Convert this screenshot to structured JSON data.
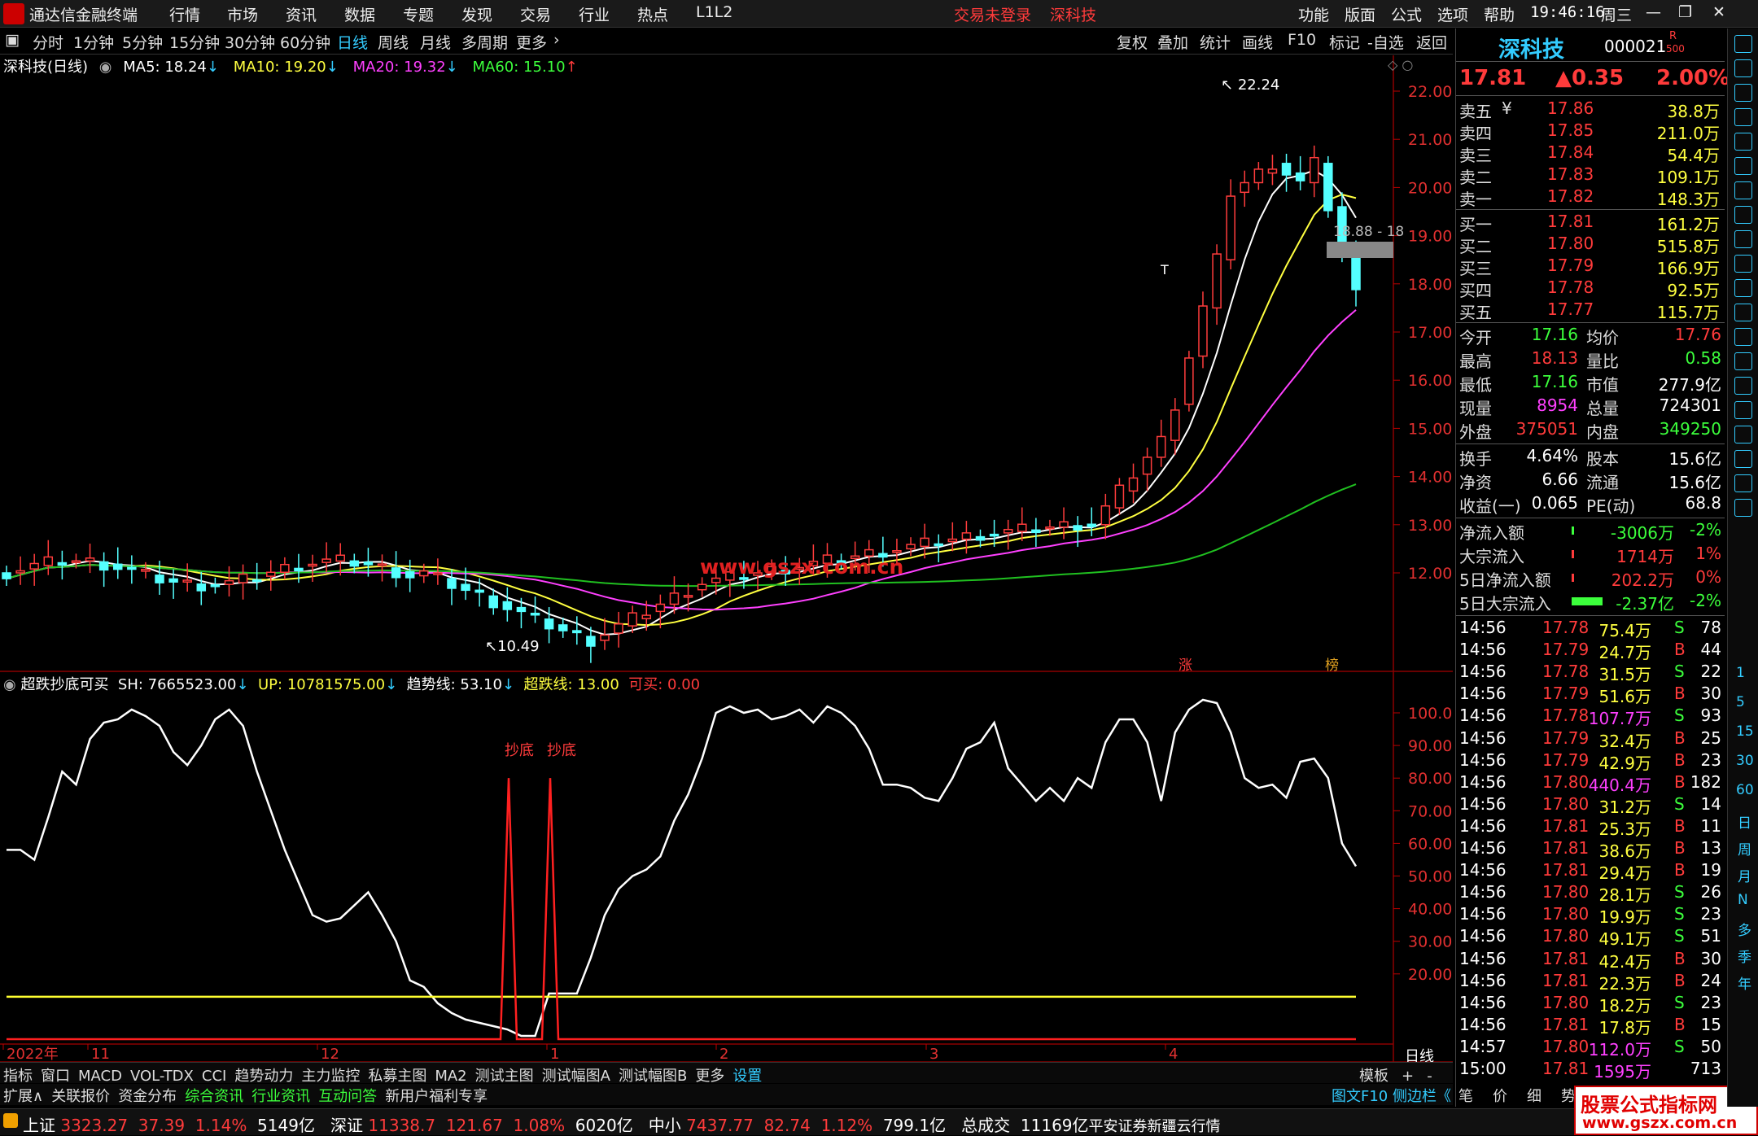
{
  "menubar": {
    "app_title": "通达信金融终端",
    "items": [
      "行情",
      "市场",
      "资讯",
      "数据",
      "专题",
      "发现",
      "交易",
      "行业",
      "热点",
      "L1L2"
    ],
    "alert": "交易未登录",
    "stock": "深科技",
    "right_items": [
      "功能",
      "版面",
      "公式",
      "选项",
      "帮助"
    ],
    "clock": "19:46:16",
    "weekday": "周三"
  },
  "tabs": {
    "periods": [
      "分时",
      "1分钟",
      "5分钟",
      "15分钟",
      "30分钟",
      "60分钟",
      "日线",
      "周线",
      "月线",
      "多周期",
      "更多"
    ],
    "tools": [
      "复权",
      "叠加",
      "统计",
      "画线",
      "F10",
      "标记",
      "-自选",
      "返回"
    ]
  },
  "chart_info": {
    "title": "深科技(日线)",
    "ma5": "MA5: 18.24",
    "ma10": "MA10: 19.20",
    "ma20": "MA20: 19.32",
    "ma60": "MA60: 15.10"
  },
  "indicator_info": {
    "name": "超跌抄底可买",
    "sh": "SH: 7665523.00",
    "up": "UP: 10781575.00",
    "trend": "趋势线: 53.10",
    "oversold": "超跌线: 13.00",
    "buy": "可买: 0.00"
  },
  "price_axis": [
    "22.00",
    "21.00",
    "20.00",
    "19.00",
    "18.00",
    "17.00",
    "16.00",
    "15.00",
    "14.00",
    "13.00",
    "12.00"
  ],
  "ind_axis": [
    "100.0",
    "90.00",
    "80.00",
    "70.00",
    "60.00",
    "50.00",
    "40.00",
    "30.00",
    "20.00"
  ],
  "annotations": {
    "high": "22.24",
    "low": "10.49",
    "current_box": "18.88 - 18",
    "watermark": "www.gszx.com.cn",
    "buy1": "抄底",
    "buy2": "抄底",
    "t_mark": "T",
    "zhang": "涨",
    "bang": "榜"
  },
  "time_axis": [
    "2022年",
    "11",
    "12",
    "1",
    "2",
    "3",
    "4"
  ],
  "time_axis_right": "日线",
  "chart_data": {
    "type": "line",
    "series": [
      {
        "name": "趋势线",
        "values": [
          58,
          58,
          55,
          68,
          82,
          78,
          92,
          97,
          98,
          101,
          99,
          96,
          88,
          84,
          90,
          98,
          101,
          96,
          82,
          70,
          58,
          48,
          38,
          36,
          37,
          41,
          45,
          38,
          30,
          18,
          16,
          11,
          8,
          6,
          5,
          4,
          3,
          1,
          1,
          14,
          14,
          14,
          25,
          38,
          46,
          50,
          52,
          56,
          67,
          75,
          86,
          100,
          102,
          100,
          101,
          98,
          99,
          101,
          97,
          102,
          100,
          96,
          89,
          78,
          78,
          77,
          74,
          73,
          80,
          89,
          91,
          97,
          83,
          78,
          73,
          77,
          73,
          80,
          77,
          91,
          98,
          98,
          91,
          73,
          94,
          101,
          104,
          103,
          94,
          80,
          77,
          78,
          74,
          85,
          86,
          80,
          60,
          53
        ]
      }
    ],
    "buy_signals": [
      {
        "x": "抄底",
        "value": 80
      },
      {
        "x": "抄底",
        "value": 80
      }
    ],
    "oversold_line": 13,
    "ylim": [
      0,
      105
    ]
  },
  "quote": {
    "name": "深科技",
    "code": "000021",
    "r_label": "R",
    "sub": "500",
    "price": "17.81",
    "change": "▲0.35",
    "pct": "2.00%",
    "asks": [
      {
        "label": "卖五",
        "sym": "¥",
        "price": "17.86",
        "vol": "38.8万"
      },
      {
        "label": "卖四",
        "sym": "",
        "price": "17.85",
        "vol": "211.0万"
      },
      {
        "label": "卖三",
        "sym": "",
        "price": "17.84",
        "vol": "54.4万"
      },
      {
        "label": "卖二",
        "sym": "",
        "price": "17.83",
        "vol": "109.1万"
      },
      {
        "label": "卖一",
        "sym": "",
        "price": "17.82",
        "vol": "148.3万"
      }
    ],
    "bids": [
      {
        "label": "买一",
        "price": "17.81",
        "vol": "161.2万"
      },
      {
        "label": "买二",
        "price": "17.80",
        "vol": "515.8万"
      },
      {
        "label": "买三",
        "price": "17.79",
        "vol": "166.9万"
      },
      {
        "label": "买四",
        "price": "17.78",
        "vol": "92.5万"
      },
      {
        "label": "买五",
        "price": "17.77",
        "vol": "115.7万"
      }
    ],
    "stats": [
      {
        "l1": "今开",
        "v1": "17.16",
        "c1": "green",
        "l2": "均价",
        "v2": "17.76",
        "c2": "red"
      },
      {
        "l1": "最高",
        "v1": "18.13",
        "c1": "red",
        "l2": "量比",
        "v2": "0.58",
        "c2": "green"
      },
      {
        "l1": "最低",
        "v1": "17.16",
        "c1": "green",
        "l2": "市值",
        "v2": "277.9亿",
        "c2": "white"
      },
      {
        "l1": "现量",
        "v1": "8954",
        "c1": "magenta",
        "l2": "总量",
        "v2": "724301",
        "c2": "white"
      },
      {
        "l1": "外盘",
        "v1": "375051",
        "c1": "red",
        "l2": "内盘",
        "v2": "349250",
        "c2": "green"
      }
    ],
    "fundamentals": [
      {
        "l1": "换手",
        "v1": "4.64%",
        "l2": "股本",
        "v2": "15.6亿"
      },
      {
        "l1": "净资",
        "v1": "6.66",
        "l2": "流通",
        "v2": "15.6亿"
      },
      {
        "l1": "收益(一)",
        "v1": "0.065",
        "l2": "PE(动)",
        "v2": "68.8"
      }
    ],
    "flows": [
      {
        "label": "净流入额",
        "val": "-3006万",
        "pct": "-2%",
        "color": "green"
      },
      {
        "label": "大宗流入",
        "val": "1714万",
        "pct": "1%",
        "color": "red"
      },
      {
        "label": "5日净流入额",
        "val": "202.2万",
        "pct": "0%",
        "color": "red"
      },
      {
        "label": "5日大宗流入",
        "val": "-2.37亿",
        "pct": "-2%",
        "color": "green"
      }
    ],
    "ticks": [
      {
        "t": "14:56",
        "p": "17.78",
        "v": "75.4万",
        "bs": "S",
        "n": "78"
      },
      {
        "t": "14:56",
        "p": "17.79",
        "v": "24.7万",
        "bs": "B",
        "n": "44"
      },
      {
        "t": "14:56",
        "p": "17.78",
        "v": "31.5万",
        "bs": "S",
        "n": "22"
      },
      {
        "t": "14:56",
        "p": "17.79",
        "v": "51.6万",
        "bs": "B",
        "n": "30"
      },
      {
        "t": "14:56",
        "p": "17.78",
        "v": "107.7万",
        "bs": "S",
        "n": "93"
      },
      {
        "t": "14:56",
        "p": "17.79",
        "v": "32.4万",
        "bs": "B",
        "n": "25"
      },
      {
        "t": "14:56",
        "p": "17.79",
        "v": "42.9万",
        "bs": "B",
        "n": "23"
      },
      {
        "t": "14:56",
        "p": "17.80",
        "v": "440.4万",
        "bs": "B",
        "n": "182"
      },
      {
        "t": "14:56",
        "p": "17.80",
        "v": "31.2万",
        "bs": "S",
        "n": "14"
      },
      {
        "t": "14:56",
        "p": "17.81",
        "v": "25.3万",
        "bs": "B",
        "n": "11"
      },
      {
        "t": "14:56",
        "p": "17.81",
        "v": "38.6万",
        "bs": "B",
        "n": "13"
      },
      {
        "t": "14:56",
        "p": "17.81",
        "v": "29.4万",
        "bs": "B",
        "n": "19"
      },
      {
        "t": "14:56",
        "p": "17.80",
        "v": "28.1万",
        "bs": "S",
        "n": "26"
      },
      {
        "t": "14:56",
        "p": "17.80",
        "v": "19.9万",
        "bs": "S",
        "n": "23"
      },
      {
        "t": "14:56",
        "p": "17.80",
        "v": "49.1万",
        "bs": "S",
        "n": "51"
      },
      {
        "t": "14:56",
        "p": "17.81",
        "v": "42.4万",
        "bs": "B",
        "n": "30"
      },
      {
        "t": "14:56",
        "p": "17.81",
        "v": "22.3万",
        "bs": "B",
        "n": "24"
      },
      {
        "t": "14:56",
        "p": "17.80",
        "v": "18.2万",
        "bs": "S",
        "n": "23"
      },
      {
        "t": "14:56",
        "p": "17.81",
        "v": "17.8万",
        "bs": "B",
        "n": "15"
      },
      {
        "t": "14:57",
        "p": "17.80",
        "v": "112.0万",
        "bs": "S",
        "n": "50"
      },
      {
        "t": "15:00",
        "p": "17.81",
        "v": "1595万",
        "bs": "",
        "n": "713"
      }
    ]
  },
  "bottom_tabs": [
    "指标",
    "窗口",
    "MACD",
    "VOL-TDX",
    "CCI",
    "趋势动力",
    "主力监控",
    "私募主图",
    "MA2",
    "测试主图",
    "测试幅图A",
    "测试幅图B",
    "更多",
    "设置"
  ],
  "bottom_right": [
    "模板",
    "+",
    "-"
  ],
  "bottom_tabs2": [
    "扩展∧",
    "关联报价",
    "资金分布",
    "综合资讯",
    "行业资讯",
    "互动问答",
    "新用户福利专享"
  ],
  "bottom_tabs2_right": [
    "图文F10",
    "侧边栏《",
    "笔",
    "价",
    "细",
    "势"
  ],
  "status": {
    "sh_label": "上证",
    "sh": "3323.27",
    "sh_chg": "37.39",
    "sh_pct": "1.14%",
    "sh_amt": "5149亿",
    "sz_label": "深证",
    "sz": "11338.7",
    "sz_chg": "121.67",
    "sz_pct": "1.08%",
    "sz_amt": "6020亿",
    "zx_label": "中小",
    "zx": "7437.77",
    "zx_chg": "82.74",
    "zx_pct": "1.12%",
    "zx_amt": "799.1亿",
    "total_label": "总成交",
    "total": "11169亿",
    "broker": "平安证券新疆云行情"
  },
  "brand": {
    "name": "股票公式指标网",
    "url": "www.gszx.com.cn"
  },
  "side_tools": [
    "日",
    "周",
    "月",
    "N",
    "多",
    "季",
    "年"
  ],
  "side_nums": [
    "1",
    "5",
    "15",
    "30",
    "60"
  ]
}
